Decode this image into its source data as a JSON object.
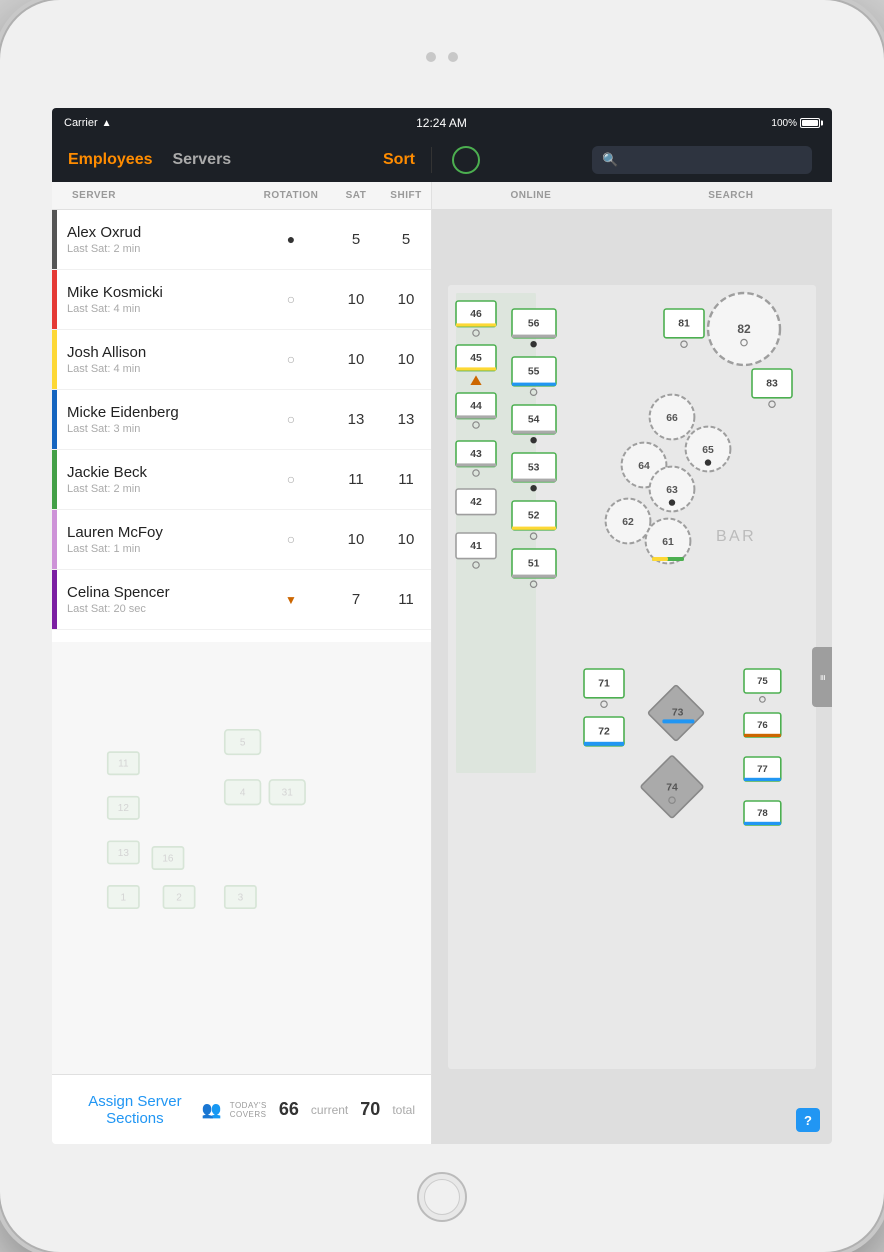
{
  "device": {
    "status_bar": {
      "carrier": "Carrier",
      "time": "12:24 AM",
      "battery": "100%"
    },
    "home_button_label": "home"
  },
  "nav": {
    "employees_tab": "Employees",
    "servers_tab": "Servers",
    "sort_label": "Sort",
    "online_label": "ONLINE",
    "search_label": "SEARCH",
    "search_placeholder": "Search"
  },
  "columns": {
    "server": "SERVER",
    "rotation": "ROTATION",
    "sat": "SAT",
    "shift": "SHIFT"
  },
  "employees": [
    {
      "name": "Alex Oxrud",
      "last_sat": "Last Sat: 2 min",
      "rotation_symbol": "filled",
      "sat": "5",
      "shift": "5",
      "color": "#555555"
    },
    {
      "name": "Mike Kosmicki",
      "last_sat": "Last Sat: 4 min",
      "rotation_symbol": "empty",
      "sat": "10",
      "shift": "10",
      "color": "#e53935"
    },
    {
      "name": "Josh Allison",
      "last_sat": "Last Sat: 4 min",
      "rotation_symbol": "empty",
      "sat": "10",
      "shift": "10",
      "color": "#fdd835"
    },
    {
      "name": "Micke Eidenberg",
      "last_sat": "Last Sat: 3 min",
      "rotation_symbol": "empty",
      "sat": "13",
      "shift": "13",
      "color": "#1565c0"
    },
    {
      "name": "Jackie Beck",
      "last_sat": "Last Sat: 2 min",
      "rotation_symbol": "empty",
      "sat": "11",
      "shift": "11",
      "color": "#43a047"
    },
    {
      "name": "Lauren McFoy",
      "last_sat": "Last Sat: 1 min",
      "rotation_symbol": "empty",
      "sat": "10",
      "shift": "10",
      "color": "#ce93d8"
    },
    {
      "name": "Celina Spencer",
      "last_sat": "Last Sat: 20 sec",
      "rotation_symbol": "triangle",
      "sat": "7",
      "shift": "11",
      "color": "#7b1fa2"
    }
  ],
  "bottom_bar": {
    "assign_label": "Assign Server Sections",
    "covers_label": "TODAY'S\nCOVERS",
    "current": "66",
    "current_label": "current",
    "total": "70",
    "total_label": "total"
  },
  "map": {
    "bar_label": "BAR",
    "help_label": "?"
  }
}
